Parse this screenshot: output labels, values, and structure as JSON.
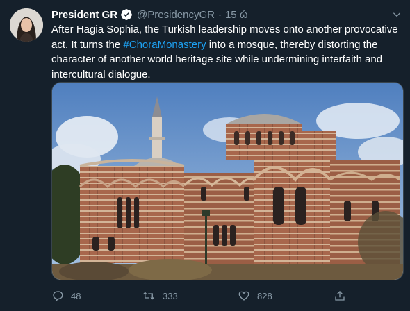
{
  "tweet": {
    "display_name": "President GR",
    "handle": "@PresidencyGR",
    "separator": "·",
    "time": "15 ώ",
    "text_before_hashtag": "After Hagia Sophia, the Turkish leadership moves onto another provocative act. It turns the ",
    "hashtag": "#ChoraMonastery",
    "text_after_hashtag": " into a mosque, thereby distorting the character of another world heritage site while undermining interfaith and intercultural dialogue."
  },
  "actions": {
    "replies": "48",
    "retweets": "333",
    "likes": "828"
  },
  "icons": {
    "verified": "verified-badge-icon",
    "caret": "chevron-down-icon",
    "reply": "reply-icon",
    "retweet": "retweet-icon",
    "like": "heart-icon",
    "share": "share-icon"
  },
  "colors": {
    "background": "#15202b",
    "accent": "#1da1f2",
    "muted": "#8899a6"
  }
}
